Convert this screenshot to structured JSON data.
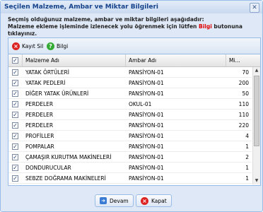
{
  "window": {
    "title": "Seçilen Malzeme, Ambar ve Miktar Bilgileri",
    "close_glyph": "✕"
  },
  "info": {
    "line1": "Seçmiş olduğunuz malzeme, ambar ve miktar bilgileri aşağıdadır:",
    "line2_before": "Malzeme ekleme işleminde izlenecek yolu öğrenmek için lütfen ",
    "line2_link": "Bilgi",
    "line2_after": " butonuna tıklayınız."
  },
  "toolbar": {
    "delete_label": "Kayıt Sil",
    "info_label": "Bilgi"
  },
  "grid": {
    "columns": [
      "Malzeme Adı",
      "Ambar Adı",
      "Mi..."
    ],
    "rows": [
      {
        "malzeme": "YATAK ÖRTÜLERİ",
        "ambar": "PANSİYON-01",
        "miktar": "70",
        "checked": true
      },
      {
        "malzeme": "YATAK PEDLERİ",
        "ambar": "PANSİYON-01",
        "miktar": "200",
        "checked": true
      },
      {
        "malzeme": "DİĞER YATAK ÜRÜNLERİ",
        "ambar": "PANSİYON-01",
        "miktar": "50",
        "checked": true
      },
      {
        "malzeme": "PERDELER",
        "ambar": "OKUL-01",
        "miktar": "110",
        "checked": true
      },
      {
        "malzeme": "PERDELER",
        "ambar": "PANSİYON-01",
        "miktar": "110",
        "checked": true
      },
      {
        "malzeme": "PERDELER",
        "ambar": "PANSİYON-01",
        "miktar": "220",
        "checked": true
      },
      {
        "malzeme": "PROFİLLER",
        "ambar": "PANSİYON-01",
        "miktar": "4",
        "checked": true
      },
      {
        "malzeme": "POMPALAR",
        "ambar": "PANSİYON-01",
        "miktar": "1",
        "checked": true
      },
      {
        "malzeme": "ÇAMAŞIR KURUTMA MAKİNELERİ",
        "ambar": "PANSİYON-01",
        "miktar": "2",
        "checked": true
      },
      {
        "malzeme": "DONDURUCULAR",
        "ambar": "PANSİYON-01",
        "miktar": "1",
        "checked": true
      },
      {
        "malzeme": "SEBZE DOĞRAMA MAKİNELERİ",
        "ambar": "PANSİYON-01",
        "miktar": "1",
        "checked": true
      }
    ]
  },
  "buttons": {
    "continue_label": "Devam",
    "close_label": "Kapat"
  },
  "colors": {
    "title": "#15428b",
    "link": "#e00000",
    "border": "#99bbe8"
  }
}
